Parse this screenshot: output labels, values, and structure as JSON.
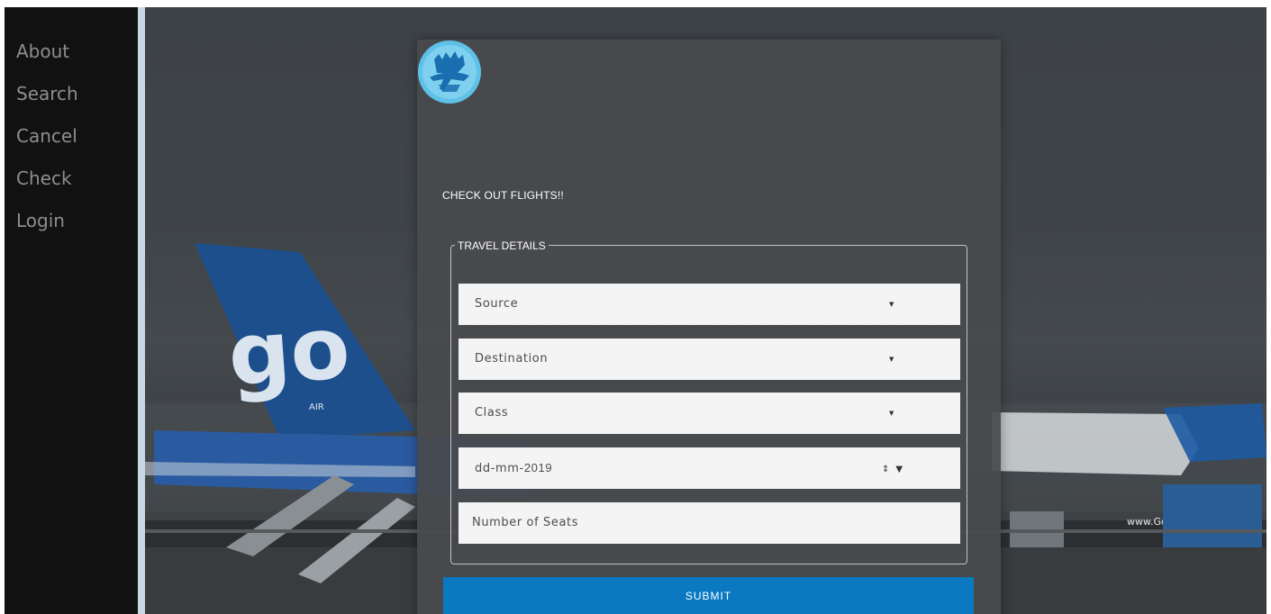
{
  "sidebar": {
    "items": [
      {
        "label": "About"
      },
      {
        "label": "Search"
      },
      {
        "label": "Cancel"
      },
      {
        "label": "Check"
      },
      {
        "label": "Login"
      }
    ]
  },
  "background": {
    "tail_text": "go",
    "tail_small_text": "AIR",
    "fuselage_text": "www.GoAir.in"
  },
  "form": {
    "title": "CHECK OUT FLIGHTS!!",
    "fieldset_legend": "TRAVEL DETAILS",
    "source_label": "Source",
    "destination_label": "Destination",
    "class_label": "Class",
    "date_prefix": "dd-mm-",
    "date_year": "2019",
    "seats_placeholder": "Number of Seats",
    "submit_label": "SUBMIT",
    "dropdown_arrow": "▼",
    "date_spin": "⇕",
    "date_arrow": "▼"
  },
  "colors": {
    "sidebar_bg": "#111111",
    "sidebar_text": "#8e8e8e",
    "card_bg": "#484a4d",
    "field_bg": "#f4f4f4",
    "submit_bg": "#0a79c2",
    "logo_bg": "#5ec1e8",
    "logo_dark": "#1a6fb0"
  },
  "icons": {
    "logo": "hand-airplane-logo-icon",
    "dropdown": "caret-down-icon",
    "date_spinner": "spinner-icon"
  }
}
